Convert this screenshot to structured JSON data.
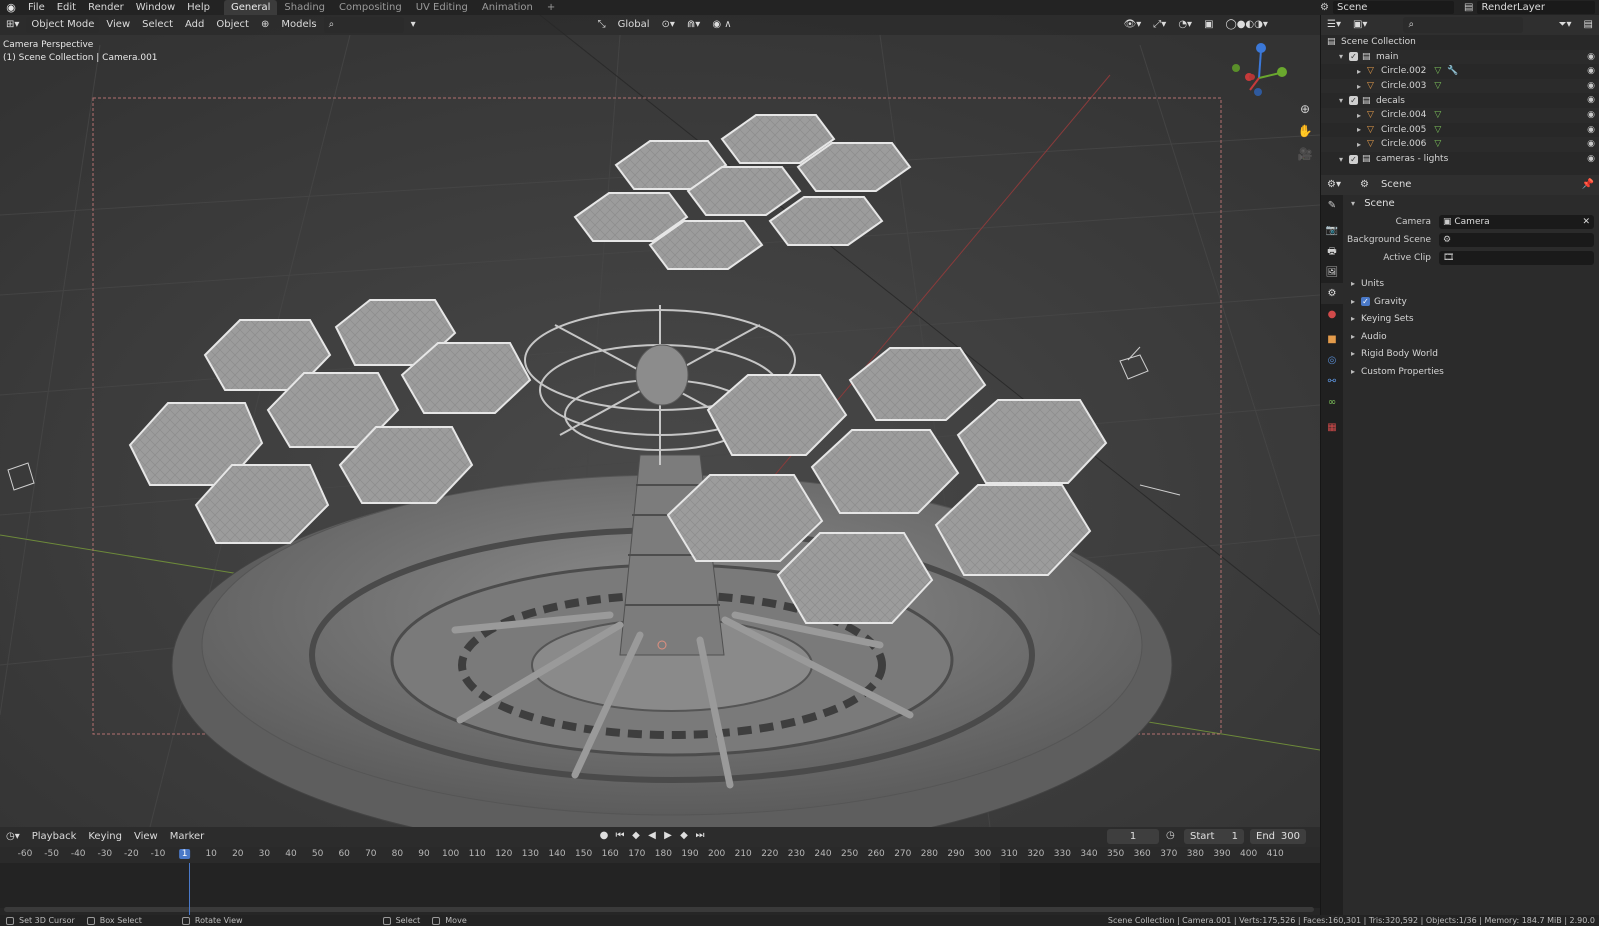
{
  "topbar": {
    "menu": [
      "File",
      "Edit",
      "Render",
      "Window",
      "Help"
    ],
    "tabs": [
      "General",
      "Shading",
      "Compositing",
      "UV Editing",
      "Animation"
    ],
    "active_tab": "General",
    "scene": "Scene",
    "render_layer": "RenderLayer"
  },
  "viewport": {
    "header": {
      "mode": "Object Mode",
      "menus": [
        "View",
        "Select",
        "Add",
        "Object"
      ],
      "collection": "Models",
      "transform": "Global"
    },
    "overlay_line1": "Camera Perspective",
    "overlay_line2": "(1) Scene Collection | Camera.001"
  },
  "timeline": {
    "menus": [
      "Playback",
      "Keying",
      "View",
      "Marker"
    ],
    "current_frame": "1",
    "start_label": "Start",
    "start": "1",
    "end_label": "End",
    "end": "300",
    "ticks": [
      "-60",
      "-50",
      "-40",
      "-30",
      "-20",
      "-10",
      "1",
      "10",
      "20",
      "30",
      "40",
      "50",
      "60",
      "70",
      "80",
      "90",
      "100",
      "110",
      "120",
      "130",
      "140",
      "150",
      "160",
      "170",
      "180",
      "190",
      "200",
      "210",
      "220",
      "230",
      "240",
      "250",
      "260",
      "270",
      "280",
      "290",
      "300",
      "310",
      "320",
      "330",
      "340",
      "350",
      "360",
      "370",
      "380",
      "390",
      "400",
      "410"
    ]
  },
  "statusbar": {
    "items": [
      "Set 3D Cursor",
      "Box Select",
      "Rotate View",
      "Select",
      "Move"
    ],
    "stats": "Scene Collection | Camera.001 | Verts:175,526 | Faces:160,301 | Tris:320,592 | Objects:1/36 | Memory: 184.7 MiB | 2.90.0"
  },
  "outliner": {
    "root": "Scene Collection",
    "rows": [
      {
        "name": "main",
        "type": "collection"
      },
      {
        "name": "Circle.002",
        "type": "object"
      },
      {
        "name": "Circle.003",
        "type": "object"
      },
      {
        "name": "decals",
        "type": "collection"
      },
      {
        "name": "Circle.004",
        "type": "object"
      },
      {
        "name": "Circle.005",
        "type": "object"
      },
      {
        "name": "Circle.006",
        "type": "object"
      },
      {
        "name": "cameras - lights",
        "type": "collection"
      }
    ]
  },
  "properties": {
    "header": "Scene",
    "panel": "Scene",
    "camera_label": "Camera",
    "camera_value": "Camera",
    "bg_scene_label": "Background Scene",
    "active_clip_label": "Active Clip",
    "subpanels": [
      "Units",
      "Gravity",
      "Keying Sets",
      "Audio",
      "Rigid Body World",
      "Custom Properties"
    ]
  },
  "colors": {
    "accent": "#4a79c8",
    "object_icon": "#e39b4b",
    "mesh_icon": "#7cc05a"
  }
}
